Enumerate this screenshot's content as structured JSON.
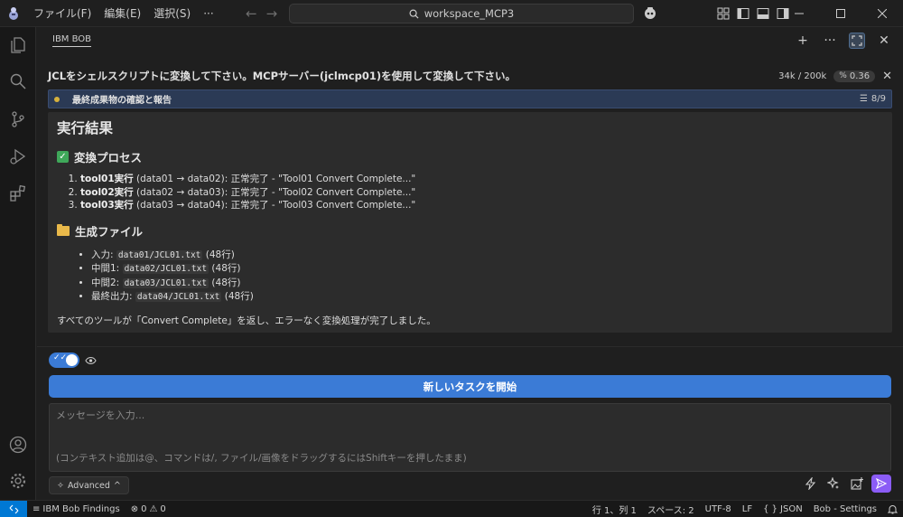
{
  "menu": {
    "file": "ファイル(F)",
    "edit": "編集(E)",
    "selection": "選択(S)",
    "more": "···"
  },
  "search": {
    "text": "workspace_MCP3"
  },
  "panel": {
    "tab": "IBM BOB"
  },
  "task": {
    "title": "JCLをシェルスクリプトに変換して下さい。MCPサーバー(jclmcp01)を使用して変換して下さい。",
    "tokens": "34k / 200k",
    "cost": "0.36"
  },
  "progress": {
    "label": "最終成果物の確認と報告",
    "count": "8/9",
    "value": 0.889
  },
  "result": {
    "heading": "実行結果",
    "process_heading": "変換プロセス",
    "steps": [
      {
        "bold": "tool01実行",
        "text": " (data01 → data02): 正常完了 - \"Tool01 Convert Complete...\""
      },
      {
        "bold": "tool02実行",
        "text": " (data02 → data03): 正常完了 - \"Tool02 Convert Complete...\""
      },
      {
        "bold": "tool03実行",
        "text": " (data03 → data04): 正常完了 - \"Tool03 Convert Complete...\""
      }
    ],
    "files_heading": "生成ファイル",
    "files": [
      {
        "label": "入力: ",
        "path": "data01/JCL01.txt",
        "suffix": " (48行)"
      },
      {
        "label": "中間1: ",
        "path": "data02/JCL01.txt",
        "suffix": " (48行)"
      },
      {
        "label": "中間2: ",
        "path": "data03/JCL01.txt",
        "suffix": " (48行)"
      },
      {
        "label": "最終出力: ",
        "path": "data04/JCL01.txt",
        "suffix": " (48行)"
      }
    ],
    "summary": "すべてのツールが「Convert Complete」を返し、エラーなく変換処理が完了しました。"
  },
  "actions": {
    "new_task": "新しいタスクを開始"
  },
  "message": {
    "placeholder": "メッセージを入力...",
    "hint": "(コンテキスト追加は@、コマンドは/, ファイル/画像をドラッグするにはShiftキーを押したまま)"
  },
  "advanced": {
    "label": "Advanced"
  },
  "status": {
    "findings": "IBM Bob Findings",
    "errors": "0",
    "warnings": "0",
    "position": "行 1、列 1",
    "spaces": "スペース: 2",
    "encoding": "UTF-8",
    "eol": "LF",
    "language": "JSON",
    "settings": "Bob - Settings"
  },
  "colors": {
    "accent": "#3b7bd6",
    "send": "#8b5cf6",
    "remote": "#0078d4"
  }
}
